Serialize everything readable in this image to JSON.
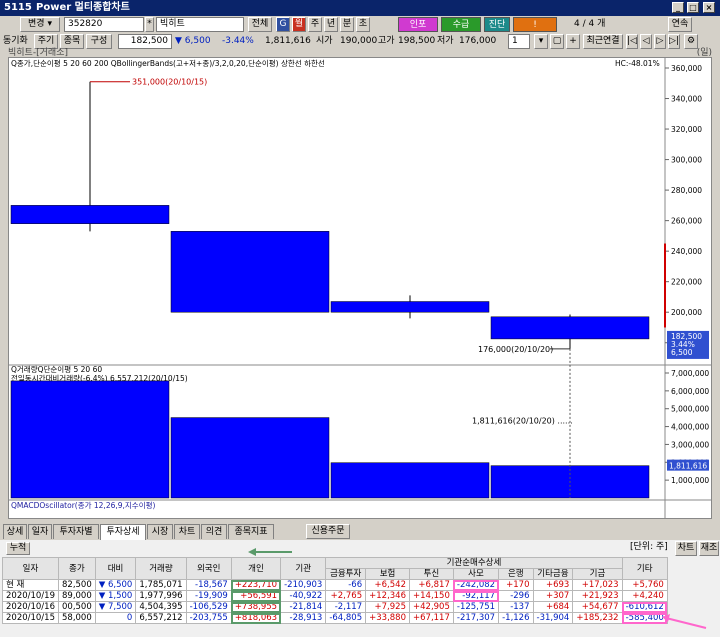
{
  "window": {
    "code": "5115",
    "title": "Power 멀티종합차트"
  },
  "toolbar1": {
    "mode": "변경",
    "stock_code": "352820",
    "stock_name": "빅히트",
    "btn_all": "전체",
    "icons": [
      "G",
      "월",
      "주",
      "년",
      "분",
      "초"
    ],
    "btn_buy": "인포",
    "btn_sell": "수급",
    "btn_jindan": "진단",
    "btn_alert": "!",
    "page": "4 / 4 개",
    "btn_link": "연속"
  },
  "toolbar2": {
    "period_label": "동기화",
    "btn_period": "주기",
    "btn_item": "종목",
    "btn_compose": "구성",
    "price": "182,500",
    "change": "6,500",
    "change_rate": "-3.44%",
    "volume": "1,811,616",
    "open_label": "시가",
    "open": "190,000",
    "high_label": "고가",
    "high": "198,500",
    "low_label": "저가",
    "low": "176,000",
    "zoom": "1",
    "btn_recent": "최근연결"
  },
  "chart": {
    "title": "빅히트-[거래소]",
    "right_tag": "(일)",
    "legend1": "Q종가,단순이평 5 20 60 200 QBollingerBands(고+저+종)/3,2,0,20,단순이평) 상한선 하한선",
    "hc": "HC:-48.01%",
    "high_note": "351,000(20/10/15)",
    "low_note": "176,000(20/10/20)",
    "vol_note": "1,811,616(20/10/20)",
    "vol_legend1": "Q거래량Q단순이평 5 20 60",
    "vol_legend2": "전일동시간대비거래량(-6.4%)",
    "vol_legend2_note": "6,557,212(20/10/15)",
    "macd_legend": "QMACDOscillator(종가 12,26,9,지수이평)",
    "price_tag": [
      "182,500",
      "3.44%",
      "6,500"
    ],
    "vol_tag": "1,811,616"
  },
  "chart_data": [
    {
      "type": "candlestick",
      "categories": [
        "20/10/15",
        "20/10/16",
        "20/10/19",
        "20/10/20"
      ],
      "open": [
        270000,
        253000,
        207000,
        197000
      ],
      "high": [
        351000,
        253000,
        211000,
        198500
      ],
      "low": [
        253000,
        200000,
        196000,
        176000
      ],
      "close": [
        258000,
        200000,
        200000,
        182500
      ],
      "ylim": [
        170000,
        360000
      ],
      "yticks": [
        180000,
        200000,
        220000,
        240000,
        260000,
        280000,
        300000,
        320000,
        340000,
        360000
      ],
      "ytick_labels": [
        "180,000",
        "200,000",
        "220,000",
        "240,000",
        "260,000",
        "280,000",
        "300,000",
        "320,000",
        "340,000",
        "360,000"
      ]
    },
    {
      "type": "bar",
      "categories": [
        "20/10/15",
        "20/10/16",
        "20/10/19",
        "20/10/20"
      ],
      "values": [
        6557212,
        4504395,
        1977996,
        1811616
      ],
      "ylim": [
        0,
        7000000
      ],
      "yticks": [
        1000000,
        2000000,
        3000000,
        4000000,
        5000000,
        6000000,
        7000000
      ],
      "ytick_labels": [
        "1,000,000",
        "2,000,000",
        "3,000,000",
        "4,000,000",
        "5,000,000",
        "6,000,000",
        "7,000,000"
      ]
    }
  ],
  "tabs": [
    "상세",
    "일자",
    "투자자별",
    "투자상세",
    "시장",
    "차트",
    "의견",
    "종목지표"
  ],
  "btn_credit": "신용주문",
  "sub": {
    "cumulative": "누적",
    "unit": "[단위: 주]",
    "btn_chart": "차트",
    "btn_reset": "재조"
  },
  "table": {
    "group_header": "기관순매수상세",
    "headers": [
      "일자",
      "종가",
      "대비",
      "거래량",
      "외국인",
      "개인",
      "기관",
      "금융투자",
      "보험",
      "투신",
      "사모",
      "은행",
      "기타금융",
      "기금",
      "기타"
    ],
    "rows": [
      [
        "현 재",
        "82,500",
        "▼ 6,500",
        "1,785,071",
        "-18,567",
        "+223,710",
        "-210,903",
        "-66",
        "+6,542",
        "+6,817",
        "-242,082",
        "+170",
        "+693",
        "+17,023",
        "+5,760"
      ],
      [
        "2020/10/19",
        "89,000",
        "▼ 1,500",
        "1,977,996",
        "-19,909",
        "+56,591",
        "-40,922",
        "+2,765",
        "+12,346",
        "+14,150",
        "-92,117",
        "-296",
        "+307",
        "+21,923",
        "+4,240"
      ],
      [
        "2020/10/16",
        "00,500",
        "▼ 7,500",
        "4,504,395",
        "-106,529",
        "+738,955",
        "-21,814",
        "-2,117",
        "+7,925",
        "+42,905",
        "-125,751",
        "-137",
        "+684",
        "+54,677",
        "-610,612"
      ],
      [
        "2020/10/15",
        "58,000",
        "0",
        "6,557,212",
        "-203,755",
        "+818,063",
        "-28,913",
        "-64,805",
        "+33,880",
        "+67,117",
        "-217,307",
        "-1,126",
        "-31,904",
        "+185,232",
        "-585,400"
      ]
    ]
  },
  "colors": {
    "candle": "#0000ff",
    "up": "#d00000",
    "down": "#0020c0",
    "highlight": "#ff66cc",
    "title_bar": "#0a246a"
  }
}
